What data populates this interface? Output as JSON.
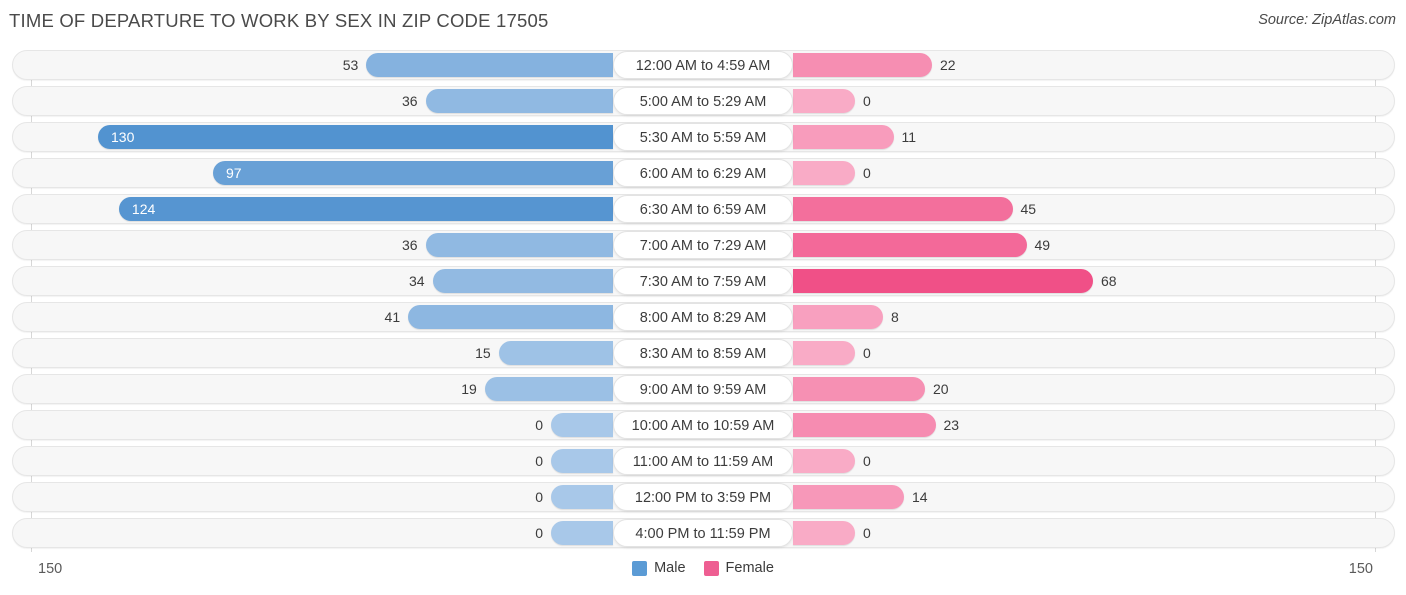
{
  "header": {
    "title": "TIME OF DEPARTURE TO WORK BY SEX IN ZIP CODE 17505",
    "source": "Source: ZipAtlas.com"
  },
  "legend": {
    "male_label": "Male",
    "female_label": "Female",
    "male_color": "#5b9bd5",
    "female_color": "#ee5e92"
  },
  "axis": {
    "left_max": "150",
    "right_max": "150"
  },
  "chart_data": {
    "type": "bar",
    "orientation": "horizontal-diverging",
    "title": "TIME OF DEPARTURE TO WORK BY SEX IN ZIP CODE 17505",
    "xlabel": "",
    "ylabel": "",
    "xlim": [
      150,
      150
    ],
    "grid": false,
    "legend_position": "bottom-center",
    "categories": [
      "12:00 AM to 4:59 AM",
      "5:00 AM to 5:29 AM",
      "5:30 AM to 5:59 AM",
      "6:00 AM to 6:29 AM",
      "6:30 AM to 6:59 AM",
      "7:00 AM to 7:29 AM",
      "7:30 AM to 7:59 AM",
      "8:00 AM to 8:29 AM",
      "8:30 AM to 8:59 AM",
      "9:00 AM to 9:59 AM",
      "10:00 AM to 10:59 AM",
      "11:00 AM to 11:59 AM",
      "12:00 PM to 3:59 PM",
      "4:00 PM to 11:59 PM"
    ],
    "series": [
      {
        "name": "Male",
        "color": "#5b9bd5",
        "values": [
          53,
          36,
          130,
          97,
          124,
          36,
          34,
          41,
          15,
          19,
          0,
          0,
          0,
          0
        ]
      },
      {
        "name": "Female",
        "color": "#ee5e92",
        "values": [
          22,
          0,
          11,
          0,
          45,
          49,
          68,
          8,
          0,
          20,
          23,
          0,
          14,
          0
        ]
      }
    ]
  }
}
